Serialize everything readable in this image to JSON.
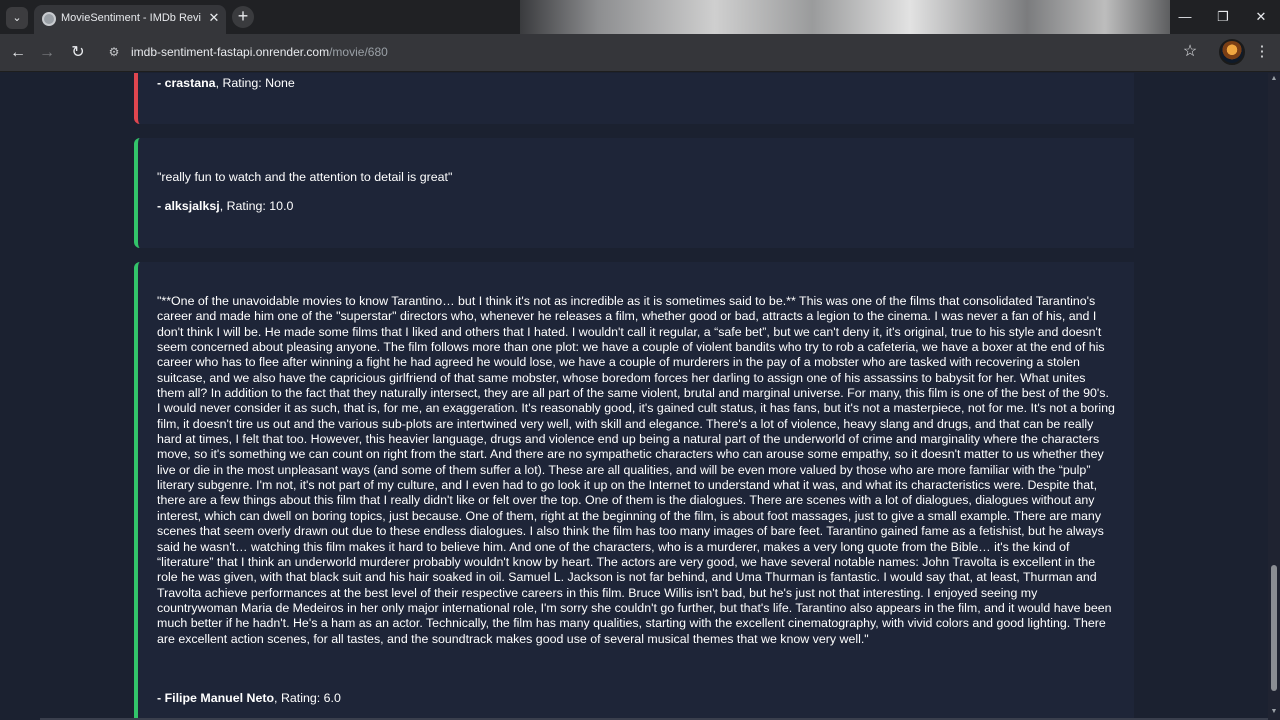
{
  "browser": {
    "tab_title": "MovieSentiment - IMDb Review",
    "url_host": "imdb-sentiment-fastapi.onrender.com",
    "url_path": "/movie/680"
  },
  "colors": {
    "page_background": "#1b2130",
    "card_background": "#1e2538",
    "negative_accent": "#e0464f",
    "positive_accent": "#33c46a"
  },
  "reviews": [
    {
      "sentiment": "negative",
      "text": "",
      "author": "crastana",
      "rating_label": "Rating: None"
    },
    {
      "sentiment": "positive",
      "text": "\"really fun to watch and the attention to detail is great\"",
      "author": "alksjalksj",
      "rating_label": "Rating: 10.0"
    },
    {
      "sentiment": "positive",
      "text": "\"**One of the unavoidable movies to know Tarantino… but I think it's not as incredible as it is sometimes said to be.** This was one of the films that consolidated Tarantino's career and made him one of the \"superstar\" directors who, whenever he releases a film, whether good or bad, attracts a legion to the cinema. I was never a fan of his, and I don't think I will be. He made some films that I liked and others that I hated. I wouldn't call it regular, a “safe bet”, but we can't deny it, it's original, true to his style and doesn't seem concerned about pleasing anyone. The film follows more than one plot: we have a couple of violent bandits who try to rob a cafeteria, we have a boxer at the end of his career who has to flee after winning a fight he had agreed he would lose, we have a couple of murderers in the pay of a mobster who are tasked with recovering a stolen suitcase, and we also have the capricious girlfriend of that same mobster, whose boredom forces her darling to assign one of his assassins to babysit for her. What unites them all? In addition to the fact that they naturally intersect, they are all part of the same violent, brutal and marginal universe. For many, this film is one of the best of the 90's. I would never consider it as such, that is, for me, an exaggeration. It's reasonably good, it's gained cult status, it has fans, but it's not a masterpiece, not for me. It's not a boring film, it doesn't tire us out and the various sub-plots are intertwined very well, with skill and elegance. There's a lot of violence, heavy slang and drugs, and that can be really hard at times, I felt that too. However, this heavier language, drugs and violence end up being a natural part of the underworld of crime and marginality where the characters move, so it's something we can count on right from the start. And there are no sympathetic characters who can arouse some empathy, so it doesn't matter to us whether they live or die in the most unpleasant ways (and some of them suffer a lot). These are all qualities, and will be even more valued by those who are more familiar with the “pulp” literary subgenre. I'm not, it's not part of my culture, and I even had to go look it up on the Internet to understand what it was, and what its characteristics were. Despite that, there are a few things about this film that I really didn't like or felt over the top. One of them is the dialogues. There are scenes with a lot of dialogues, dialogues without any interest, which can dwell on boring topics, just because. One of them, right at the beginning of the film, is about foot massages, just to give a small example. There are many scenes that seem overly drawn out due to these endless dialogues. I also think the film has too many images of bare feet. Tarantino gained fame as a fetishist, but he always said he wasn't… watching this film makes it hard to believe him. And one of the characters, who is a murderer, makes a very long quote from the Bible… it's the kind of “literature” that I think an underworld murderer probably wouldn't know by heart. The actors are very good, we have several notable names: John Travolta is excellent in the role he was given, with that black suit and his hair soaked in oil. Samuel L. Jackson is not far behind, and Uma Thurman is fantastic. I would say that, at least, Thurman and Travolta achieve performances at the best level of their respective careers in this film. Bruce Willis isn't bad, but he's just not that interesting. I enjoyed seeing my countrywoman Maria de Medeiros in her only major international role, I'm sorry she couldn't go further, but that's life. Tarantino also appears in the film, and it would have been much better if he hadn't. He's a ham as an actor. Technically, the film has many qualities, starting with the excellent cinematography, with vivid colors and good lighting. There are excellent action scenes, for all tastes, and the soundtrack makes good use of several musical themes that we know very well.\"",
      "author": "Filipe Manuel Neto",
      "rating_label": "Rating: 6.0"
    }
  ]
}
